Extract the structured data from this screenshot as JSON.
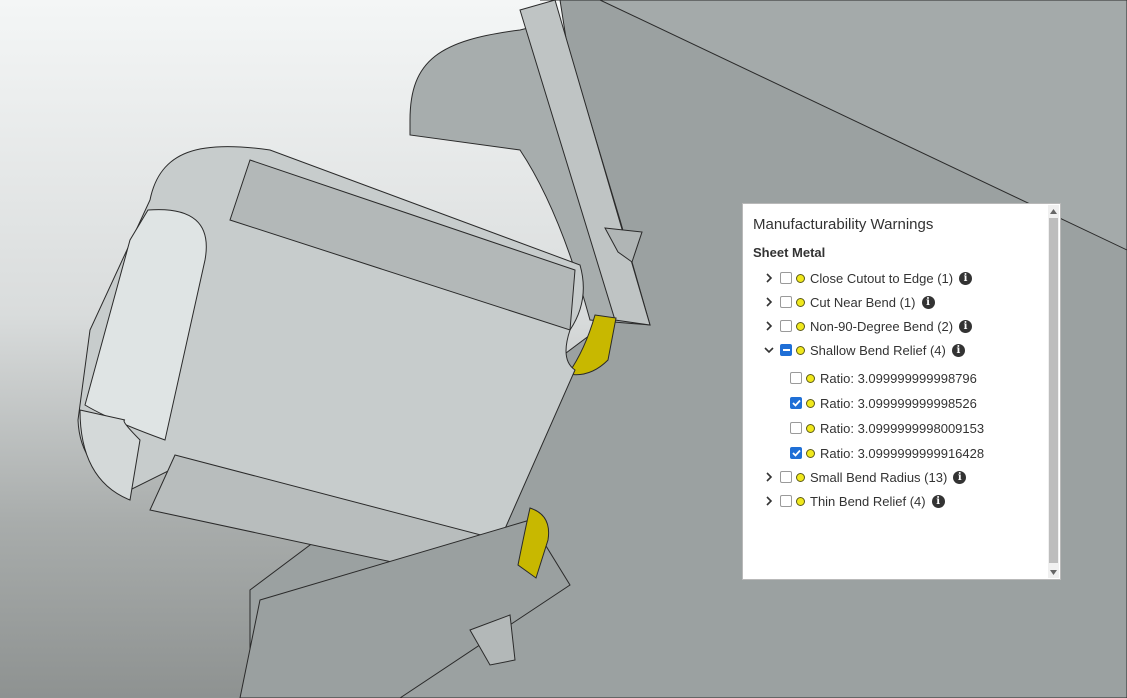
{
  "panel": {
    "title": "Manufacturability Warnings",
    "section": "Sheet Metal",
    "items": [
      {
        "label": "Close Cutout to Edge (1)",
        "expanded": false,
        "checked": "none",
        "icon": "chevron-right-icon"
      },
      {
        "label": "Cut Near Bend (1)",
        "expanded": false,
        "checked": "none",
        "icon": "chevron-right-icon"
      },
      {
        "label": "Non-90-Degree Bend (2)",
        "expanded": false,
        "checked": "none",
        "icon": "chevron-right-icon"
      },
      {
        "label": "Shallow Bend Relief (4)",
        "expanded": true,
        "checked": "partial",
        "icon": "chevron-down-icon",
        "children": [
          {
            "label": "Ratio: 3.099999999998796",
            "checked": false
          },
          {
            "label": "Ratio: 3.099999999998526",
            "checked": true
          },
          {
            "label": "Ratio: 3.0999999998009153",
            "checked": false
          },
          {
            "label": "Ratio: 3.0999999999916428",
            "checked": true
          }
        ]
      },
      {
        "label": "Small Bend Radius (13)",
        "expanded": false,
        "checked": "none",
        "icon": "chevron-right-icon"
      },
      {
        "label": "Thin Bend Relief (4)",
        "expanded": false,
        "checked": "none",
        "icon": "chevron-right-icon"
      }
    ],
    "info_glyph": "i"
  },
  "colors": {
    "warning_dot": "#f0e81c",
    "checkbox_checked": "#1f6fd6",
    "highlight_face": "#c8b800"
  }
}
